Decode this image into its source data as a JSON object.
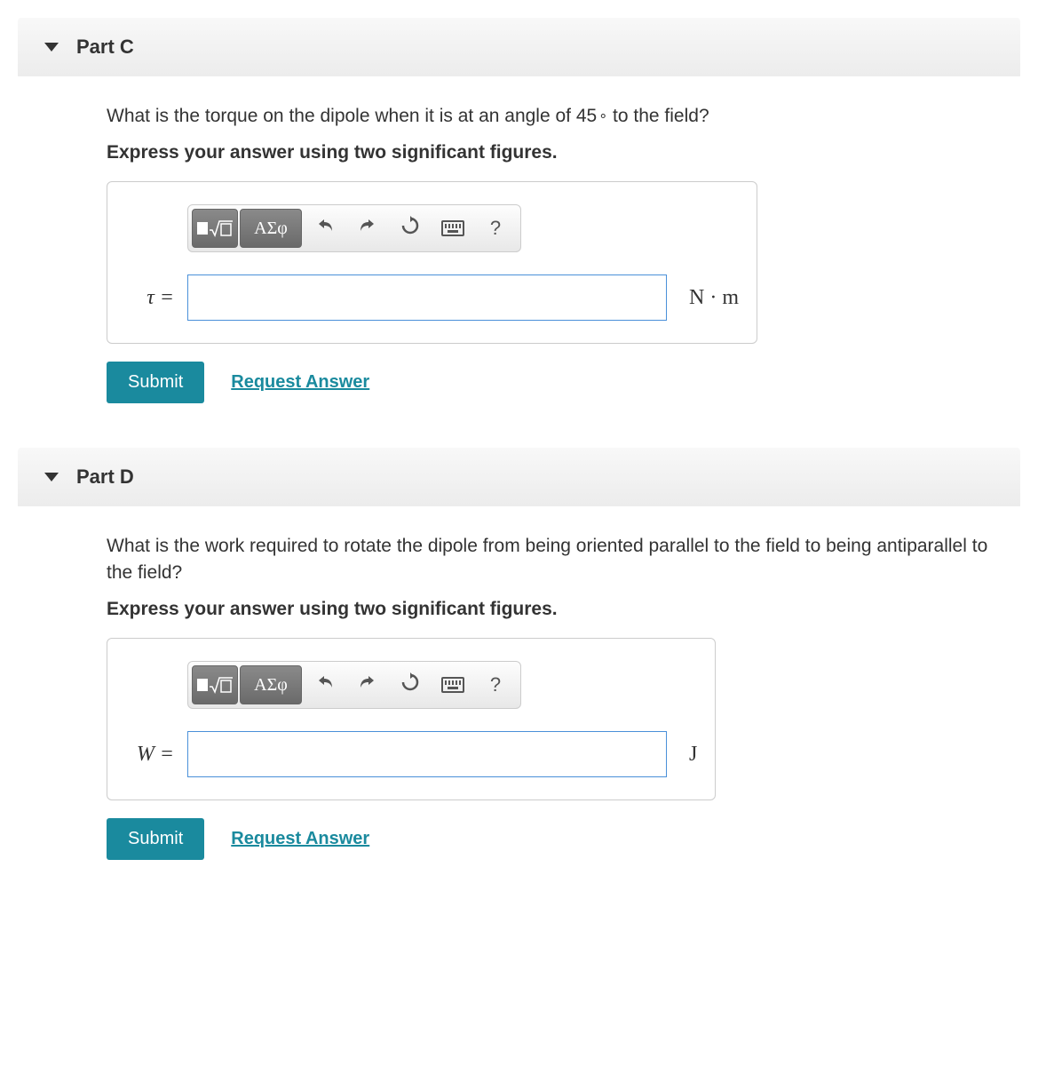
{
  "parts": {
    "c": {
      "title": "Part C",
      "question_prefix": "What is the torque on the dipole when it is at an angle of 45",
      "question_suffix": " to the field?",
      "degree": "∘",
      "instruction": "Express your answer using two significant figures.",
      "var_label": "τ =",
      "unit_label": "N · m",
      "submit": "Submit",
      "request": "Request Answer"
    },
    "d": {
      "title": "Part D",
      "question": "What is the work required to rotate the dipole from being oriented parallel to the field to being antiparallel to the field?",
      "instruction": "Express your answer using two significant figures.",
      "var_label": "W =",
      "unit_label": "J",
      "submit": "Submit",
      "request": "Request Answer"
    }
  },
  "toolbar": {
    "greek": "ΑΣφ",
    "help": "?"
  }
}
